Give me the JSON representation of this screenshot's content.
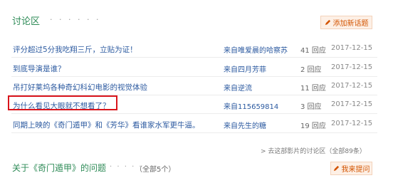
{
  "discussion": {
    "title": "讨论区",
    "dots": "· · · · · ·",
    "add_topic_label": "添加新话题",
    "rows": [
      {
        "topic": "评分超过5分我吃翔三斤，立贴为证！",
        "author": "来自唯爱晨的哈察苏",
        "replies": "41 回应",
        "date": "2017-12-15"
      },
      {
        "topic": "到底导演是谁？",
        "author": "来自四月芳菲",
        "replies": "2 回应",
        "date": "2017-12-15"
      },
      {
        "topic": "吊打好莱坞各种奇幻科幻电影的视觉体验",
        "author": "来自逆流",
        "replies": "11 回应",
        "date": "2017-12-15"
      },
      {
        "topic": "为什么看见大眼就不想看了？",
        "author": "来自115659814",
        "replies": "3 回应",
        "date": "2017-12-15"
      },
      {
        "topic": "同期上映的《奇门遁甲》和《芳华》看谁家水军更牛逼。",
        "author": "来自先生的糖",
        "replies": "19 回应",
        "date": "2017-12-15"
      }
    ],
    "more_link": "> 去这部影片的讨论区（全部89条）"
  },
  "about": {
    "title": "关于《奇门遁甲》的问题",
    "dots": "· · · · · ·",
    "count": "（全部5个）",
    "ask_label": "我来提问"
  },
  "colors": {
    "section_green": "#2e8b57",
    "link_blue": "#2c5aa0",
    "button_orange": "#d35400",
    "highlight_red": "#d9141b"
  }
}
